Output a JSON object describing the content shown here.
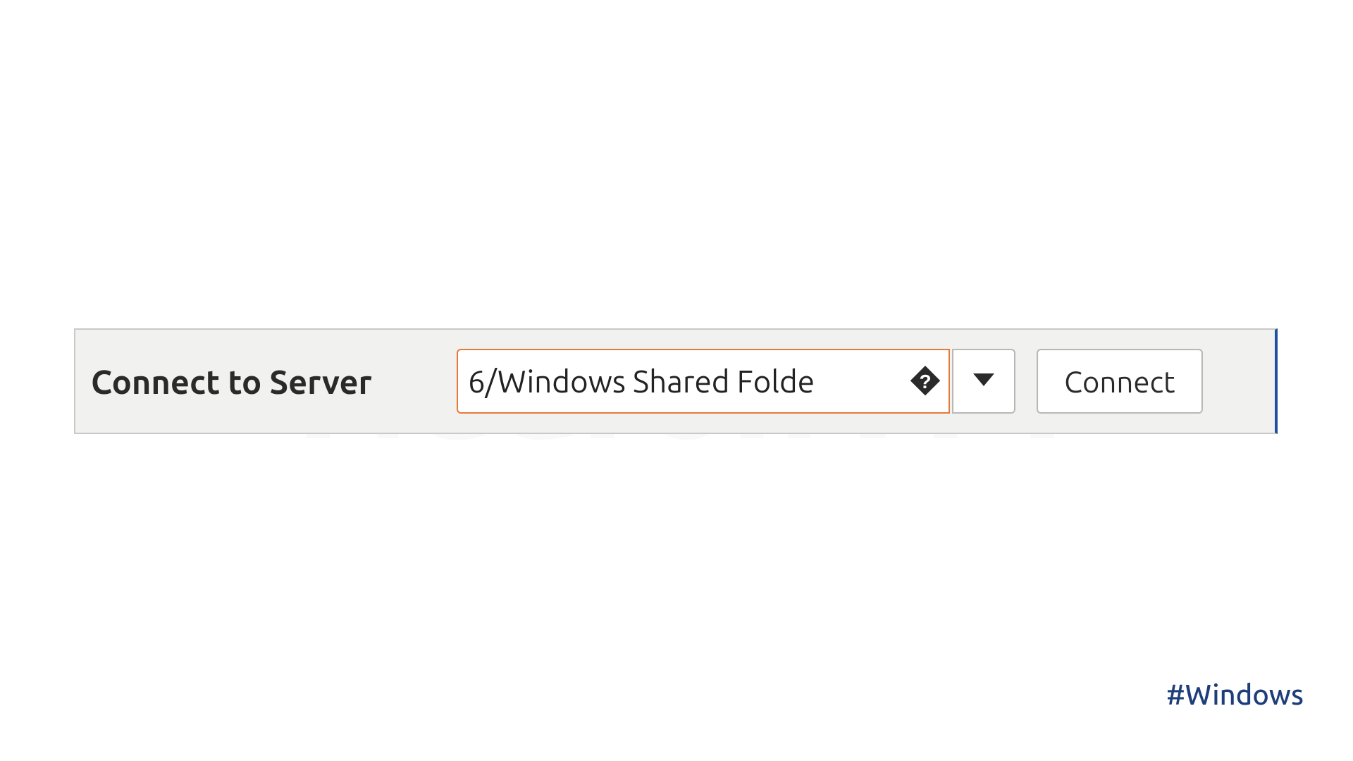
{
  "connect_panel": {
    "label": "Connect to Server",
    "address_value": "6/Windows Shared Folde",
    "connect_button": "Connect"
  },
  "watermark": "NeuronVM",
  "hashtag": "#Windows"
}
